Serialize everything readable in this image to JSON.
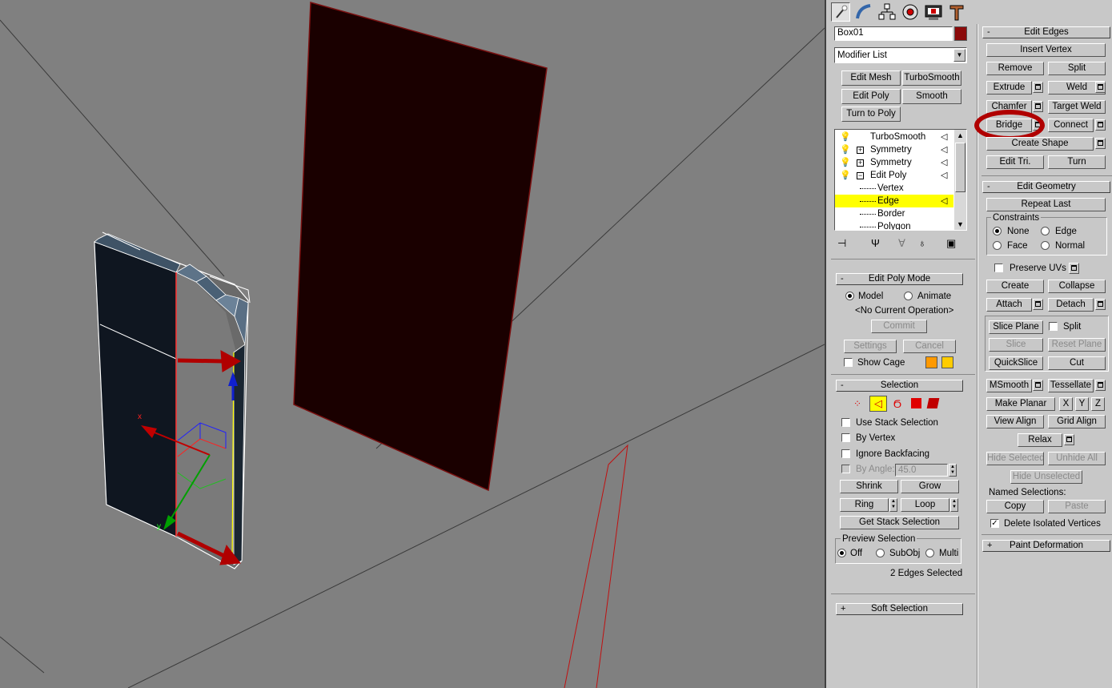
{
  "object": {
    "name": "Box01",
    "color": "#8b0a0a"
  },
  "modifier_list": {
    "selected": "Modifier List"
  },
  "modifier_buttons": [
    "Edit Mesh",
    "TurboSmooth",
    "Edit Poly",
    "Smooth",
    "Turn to Poly"
  ],
  "stack": {
    "items": [
      {
        "label": "TurboSmooth"
      },
      {
        "label": "Symmetry"
      },
      {
        "label": "Symmetry"
      },
      {
        "label": "Edit Poly"
      },
      {
        "label": "Vertex"
      },
      {
        "label": "Edge"
      },
      {
        "label": "Border"
      },
      {
        "label": "Polygon"
      }
    ],
    "selected_index": 5
  },
  "edit_poly_mode": {
    "title": "Edit Poly Mode",
    "model_label": "Model",
    "animate_label": "Animate",
    "operation": "<No Current Operation>",
    "commit": "Commit",
    "settings": "Settings",
    "cancel": "Cancel",
    "show_cage": "Show Cage",
    "cage_colors": [
      "#ff9900",
      "#ffcc00"
    ]
  },
  "selection": {
    "title": "Selection",
    "use_stack": "Use Stack Selection",
    "by_vertex": "By Vertex",
    "ignore_backfacing": "Ignore Backfacing",
    "by_angle": "By Angle:",
    "angle_value": "45.0",
    "shrink": "Shrink",
    "grow": "Grow",
    "ring": "Ring",
    "loop": "Loop",
    "get_stack": "Get Stack Selection",
    "preview_title": "Preview Selection",
    "preview_off": "Off",
    "preview_subobj": "SubObj",
    "preview_multi": "Multi",
    "status": "2 Edges Selected"
  },
  "soft_selection": {
    "title": "Soft Selection"
  },
  "edit_edges": {
    "title": "Edit Edges",
    "insert_vertex": "Insert Vertex",
    "remove": "Remove",
    "split": "Split",
    "extrude": "Extrude",
    "weld": "Weld",
    "chamfer": "Chamfer",
    "target_weld": "Target Weld",
    "bridge": "Bridge",
    "connect": "Connect",
    "create_shape": "Create Shape",
    "edit_tri": "Edit Tri.",
    "turn": "Turn"
  },
  "edit_geometry": {
    "title": "Edit Geometry",
    "repeat_last": "Repeat Last",
    "constraints": "Constraints",
    "none": "None",
    "edge": "Edge",
    "face": "Face",
    "normal": "Normal",
    "preserve_uvs": "Preserve UVs",
    "create": "Create",
    "collapse": "Collapse",
    "attach": "Attach",
    "detach": "Detach",
    "slice_plane": "Slice Plane",
    "split": "Split",
    "slice": "Slice",
    "reset_plane": "Reset Plane",
    "quickslice": "QuickSlice",
    "cut": "Cut",
    "msmooth": "MSmooth",
    "tessellate": "Tessellate",
    "make_planar": "Make Planar",
    "x": "X",
    "y": "Y",
    "z": "Z",
    "view_align": "View Align",
    "grid_align": "Grid Align",
    "relax": "Relax",
    "hide_selected": "Hide Selected",
    "unhide_all": "Unhide All",
    "hide_unselected": "Hide Unselected",
    "named_selections": "Named Selections:",
    "copy": "Copy",
    "paste": "Paste",
    "delete_isolated": "Delete Isolated Vertices"
  },
  "paint_deformation": {
    "title": "Paint Deformation"
  },
  "gizmo_labels": {
    "x": "x",
    "y": "y"
  },
  "colors": {
    "accent": "#b00000",
    "selected_row": "#ffff00",
    "viewport_bg": "#808080",
    "highlight_ellipse": "#b00000"
  }
}
